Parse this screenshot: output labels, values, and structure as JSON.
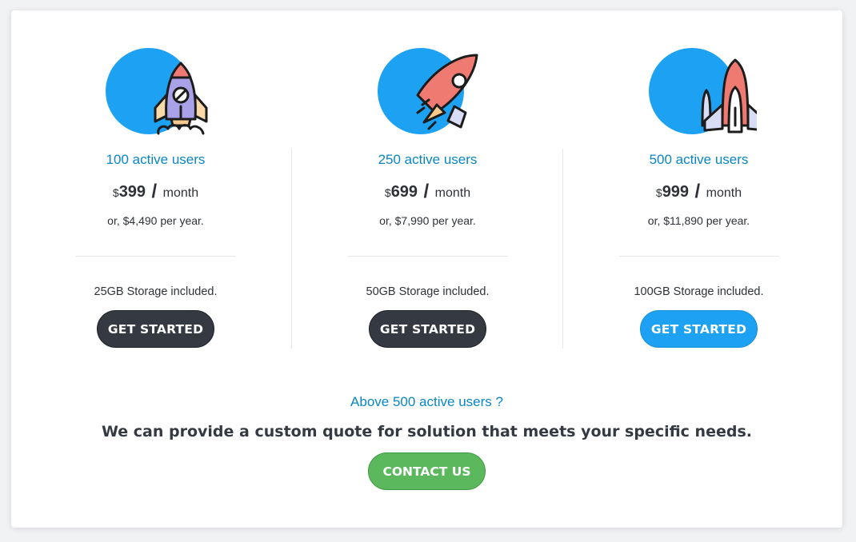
{
  "plans": [
    {
      "icon": "rocket-upright-icon",
      "users": "100 active users",
      "currency": "$",
      "amount": "399",
      "slash": "/",
      "period": "month",
      "yearly": "or, $4,490 per year.",
      "storage": "25GB Storage included.",
      "button": "GET STARTED"
    },
    {
      "icon": "rocket-diagonal-icon",
      "users": "250 active users",
      "currency": "$",
      "amount": "699",
      "slash": "/",
      "period": "month",
      "yearly": "or, $7,990 per year.",
      "storage": "50GB Storage included.",
      "button": "GET STARTED"
    },
    {
      "icon": "space-shuttle-icon",
      "users": "500 active users",
      "currency": "$",
      "amount": "999",
      "slash": "/",
      "period": "month",
      "yearly": "or, $11,890 per year.",
      "storage": "100GB Storage included.",
      "button": "GET STARTED"
    }
  ],
  "custom": {
    "question": "Above 500 active users ?",
    "message": "We can provide a custom quote for solution that meets your specific needs.",
    "button": "CONTACT US"
  },
  "colors": {
    "accent_blue": "#1da1f2",
    "link_blue": "#0a86c4",
    "dark_button": "#353a42",
    "green_button": "#5cb85c"
  }
}
